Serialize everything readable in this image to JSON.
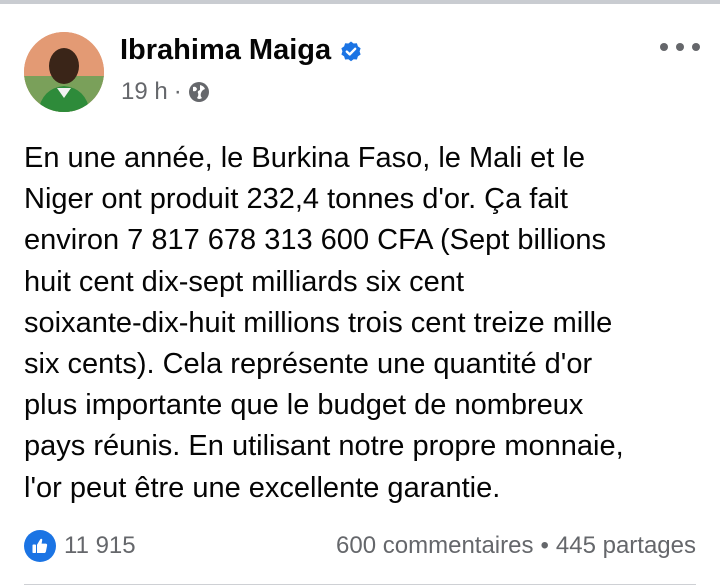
{
  "post": {
    "author_name": "Ibrahima Maiga",
    "timestamp": "19 h",
    "meta_separator": "·",
    "verified_icon": "verified-badge-icon",
    "audience_icon": "globe-icon",
    "menu_icon": "more-options-icon",
    "body_lines": [
      "En une année, le Burkina Faso, le Mali et le",
      "Niger ont produit 232,4 tonnes d'or. Ça fait",
      "environ 7 817 678 313 600 CFA (Sept billions",
      "huit cent dix-sept milliards six cent",
      "soixante-dix-huit millions trois cent treize mille",
      "six cents).  Cela représente une quantité d'or",
      "plus importante que le budget de nombreux",
      "pays réunis. En utilisant notre propre monnaie,",
      "l'or peut être une excellente garantie."
    ],
    "reactions": {
      "icon": "like-icon",
      "count": "11 915"
    },
    "comments": "600 commentaires",
    "stats_separator": "•",
    "shares": "445 partages"
  },
  "colors": {
    "primary_text": "#050505",
    "secondary_text": "#65676b",
    "accent_blue": "#1b74e4"
  }
}
